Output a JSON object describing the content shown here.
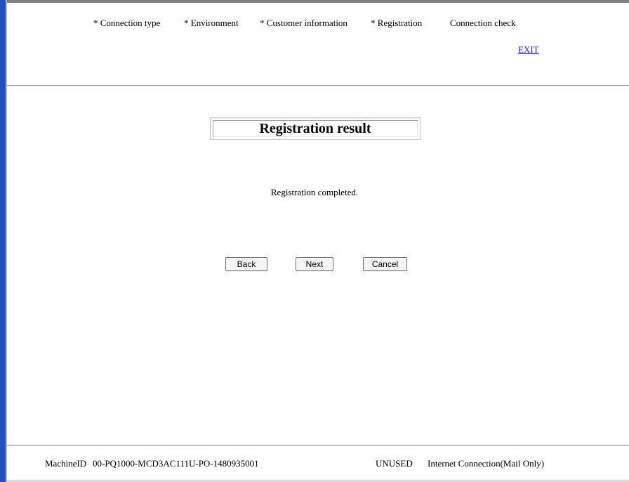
{
  "wizard_steps": [
    "* Connection type",
    "* Environment",
    "* Customer information",
    "* Registration",
    "Connection check"
  ],
  "exit_label": "EXIT",
  "title": "Registration result",
  "message": "Registration completed.",
  "buttons": {
    "back": "Back",
    "next": "Next",
    "cancel": "Cancel"
  },
  "footer": {
    "machine_id_label": "MachineID",
    "machine_id_value": "00-PQ1000-MCD3AC111U-PO-1480935001",
    "status": "UNUSED",
    "connection_mode": "Internet Connection(Mail Only)"
  },
  "colors": {
    "accent_bar": "#1f4fc4",
    "link": "#1a1aff"
  }
}
